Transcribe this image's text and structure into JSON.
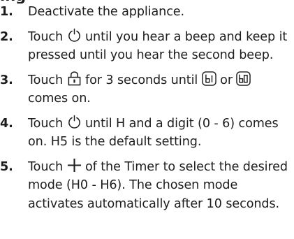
{
  "heading_fragment": "ing",
  "steps": [
    {
      "number": "1.",
      "text": "Deactivate the appliance."
    },
    {
      "number": "2.",
      "text_a": "Touch",
      "icon": "power-icon",
      "text_b": "until you hear a beep and keep it pressed until you hear the second beep."
    },
    {
      "number": "3.",
      "text_a": "Touch",
      "icon_1": "lock-icon",
      "text_b": "for 3 seconds until",
      "icon_2": "display-b1-icon",
      "text_c": "or",
      "icon_3": "display-b0-icon",
      "text_d": "comes on."
    },
    {
      "number": "4.",
      "text_a": "Touch",
      "icon": "power-icon",
      "text_b": "until H and a digit (0 - 6) comes on. H5 is the default setting."
    },
    {
      "number": "5.",
      "text_a": "Touch",
      "icon": "plus-icon",
      "text_b": "of the Timer to select the desired mode (H0 - H6). The chosen mode activates automatically after 10 seconds."
    }
  ],
  "colors": {
    "text": "#1d1d1d",
    "number": "#1d1d1d"
  }
}
